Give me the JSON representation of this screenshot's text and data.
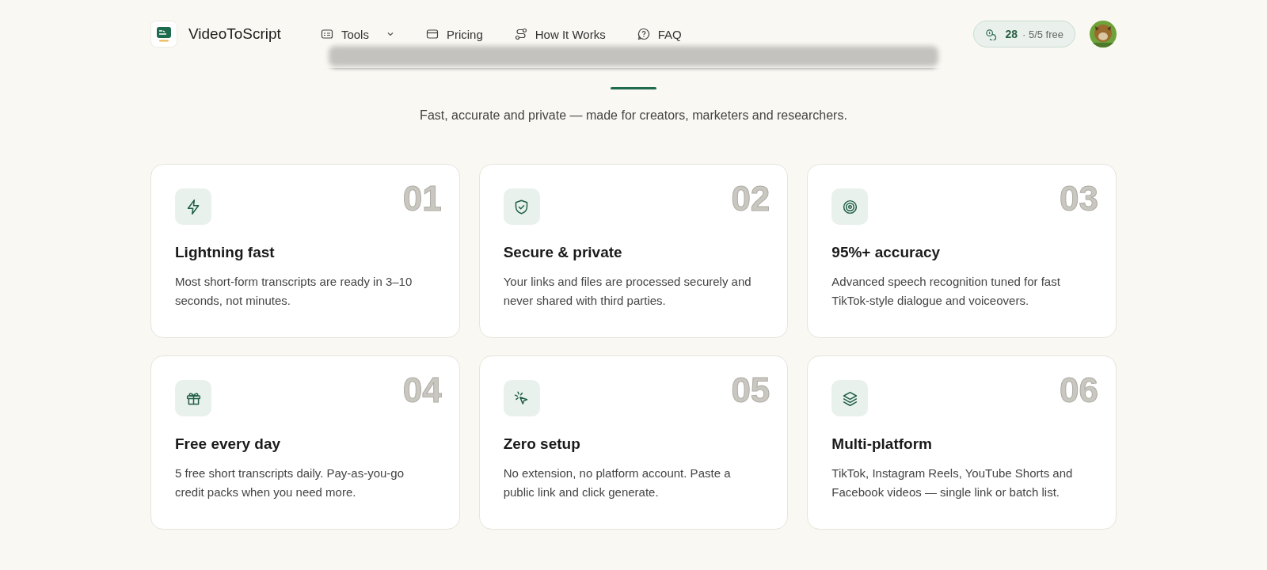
{
  "nav": {
    "brand": "VideoToScript",
    "links": [
      {
        "label": "Tools",
        "dropdown": true
      },
      {
        "label": "Pricing",
        "dropdown": false
      },
      {
        "label": "How It Works",
        "dropdown": false
      },
      {
        "label": "FAQ",
        "dropdown": false
      }
    ],
    "credits": {
      "count": "28",
      "free": "· 5/5 free"
    }
  },
  "hero": {
    "subtitle": "Fast, accurate and private — made for creators, marketers and researchers."
  },
  "features": [
    {
      "number": "01",
      "title": "Lightning fast",
      "text": "Most short-form transcripts are ready in 3–10 seconds, not minutes."
    },
    {
      "number": "02",
      "title": "Secure & private",
      "text": "Your links and files are processed securely and never shared with third parties."
    },
    {
      "number": "03",
      "title": "95%+ accuracy",
      "text": "Advanced speech recognition tuned for fast TikTok-style dialogue and voiceovers."
    },
    {
      "number": "04",
      "title": "Free every day",
      "text": "5 free short transcripts daily. Pay-as-you-go credit packs when you need more."
    },
    {
      "number": "05",
      "title": "Zero setup",
      "text": "No extension, no platform account. Paste a public link and click generate."
    },
    {
      "number": "06",
      "title": "Multi-platform",
      "text": "TikTok, Instagram Reels, YouTube Shorts and Facebook videos — single link or batch list."
    }
  ]
}
